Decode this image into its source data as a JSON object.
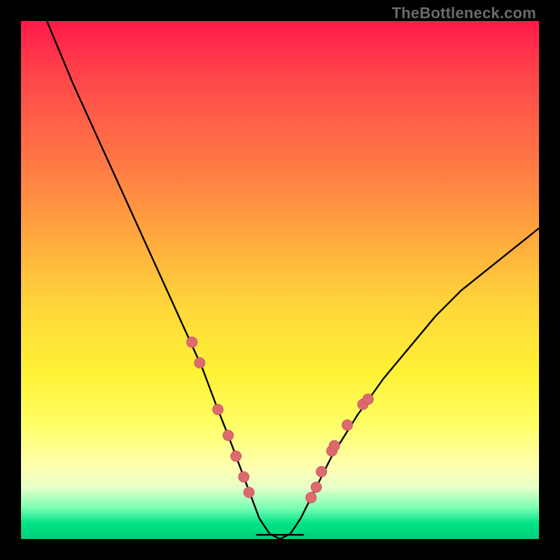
{
  "watermark": "TheBottleneck.com",
  "chart_data": {
    "type": "line",
    "title": "",
    "xlabel": "",
    "ylabel": "",
    "xlim": [
      0,
      100
    ],
    "ylim": [
      0,
      100
    ],
    "grid": false,
    "legend": false,
    "background_gradient": {
      "top": "#ff1a4a",
      "bottom": "#00d07a",
      "note": "vertical red→orange→yellow→green gradient; y≈0 green, y≈100 red"
    },
    "series": [
      {
        "name": "bottleneck-curve",
        "note": "Asymmetric V-shaped curve. Minimum ~0 around x≈47–52. Left branch reaches ~100 at x≈5; right branch reaches ~60 at x≈100.",
        "x": [
          5,
          10,
          15,
          20,
          25,
          30,
          35,
          38,
          40,
          43,
          46,
          48,
          50,
          52,
          54,
          57,
          60,
          65,
          70,
          75,
          80,
          85,
          90,
          95,
          100
        ],
        "y": [
          100,
          88,
          77,
          66,
          55,
          44,
          33,
          25,
          20,
          12,
          4,
          1,
          0,
          1,
          4,
          10,
          16,
          24,
          31,
          37,
          43,
          48,
          52,
          56,
          60
        ]
      }
    ],
    "markers": {
      "name": "highlight-dots",
      "note": "salmon dots clustered on both branches near the trough",
      "points": [
        {
          "x": 33,
          "y": 38
        },
        {
          "x": 34.5,
          "y": 34
        },
        {
          "x": 38,
          "y": 25
        },
        {
          "x": 40,
          "y": 20
        },
        {
          "x": 41.5,
          "y": 16
        },
        {
          "x": 43,
          "y": 12
        },
        {
          "x": 44,
          "y": 9
        },
        {
          "x": 56,
          "y": 8
        },
        {
          "x": 57,
          "y": 10
        },
        {
          "x": 58,
          "y": 13
        },
        {
          "x": 60,
          "y": 17
        },
        {
          "x": 60.5,
          "y": 18
        },
        {
          "x": 63,
          "y": 22
        },
        {
          "x": 66,
          "y": 26
        },
        {
          "x": 67,
          "y": 27
        }
      ]
    },
    "trough_band": {
      "x_start": 45.5,
      "x_end": 54.5,
      "y": 0.8
    }
  }
}
